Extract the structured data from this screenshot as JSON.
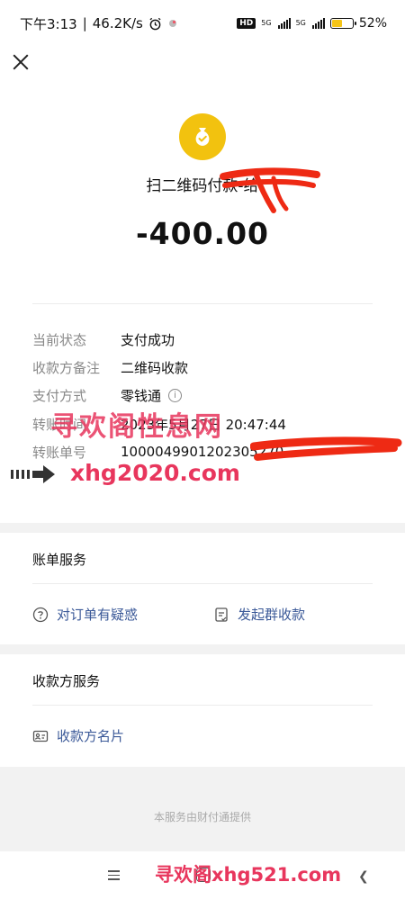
{
  "status_bar": {
    "time": "下午3:13",
    "speed": "46.2K/s",
    "hd": "HD",
    "net1": "5G",
    "net2": "5G",
    "battery_percent": "52%",
    "battery_level": 0.52
  },
  "header": {
    "title": "扫二维码付款-给",
    "amount": "-400.00"
  },
  "details": [
    {
      "label": "当前状态",
      "value": "支付成功"
    },
    {
      "label": "收款方备注",
      "value": "二维码收款"
    },
    {
      "label": "支付方式",
      "value": "零钱通"
    },
    {
      "label": "转账时间",
      "value": "2023年5月27日 20:47:44"
    },
    {
      "label": "转账单号",
      "value": "1000049901202305270"
    }
  ],
  "watermarks": {
    "site_title": "寻欢阁性息网",
    "site_url": "xhg2020.com",
    "bottom": "寻欢阁xhg521.com"
  },
  "bill_service": {
    "title": "账单服务",
    "items": [
      {
        "label": "对订单有疑惑",
        "icon": "question-circle-icon"
      },
      {
        "label": "发起群收款",
        "icon": "document-icon"
      }
    ]
  },
  "payee_service": {
    "title": "收款方服务",
    "items": [
      {
        "label": "收款方名片",
        "icon": "contact-card-icon"
      }
    ]
  },
  "footer": {
    "text": "本服务由财付通提供"
  },
  "colors": {
    "accent_yellow": "#f2c20f",
    "link_blue": "#3b5998",
    "redaction_red": "#ee2a14",
    "watermark": "#e8365d"
  }
}
